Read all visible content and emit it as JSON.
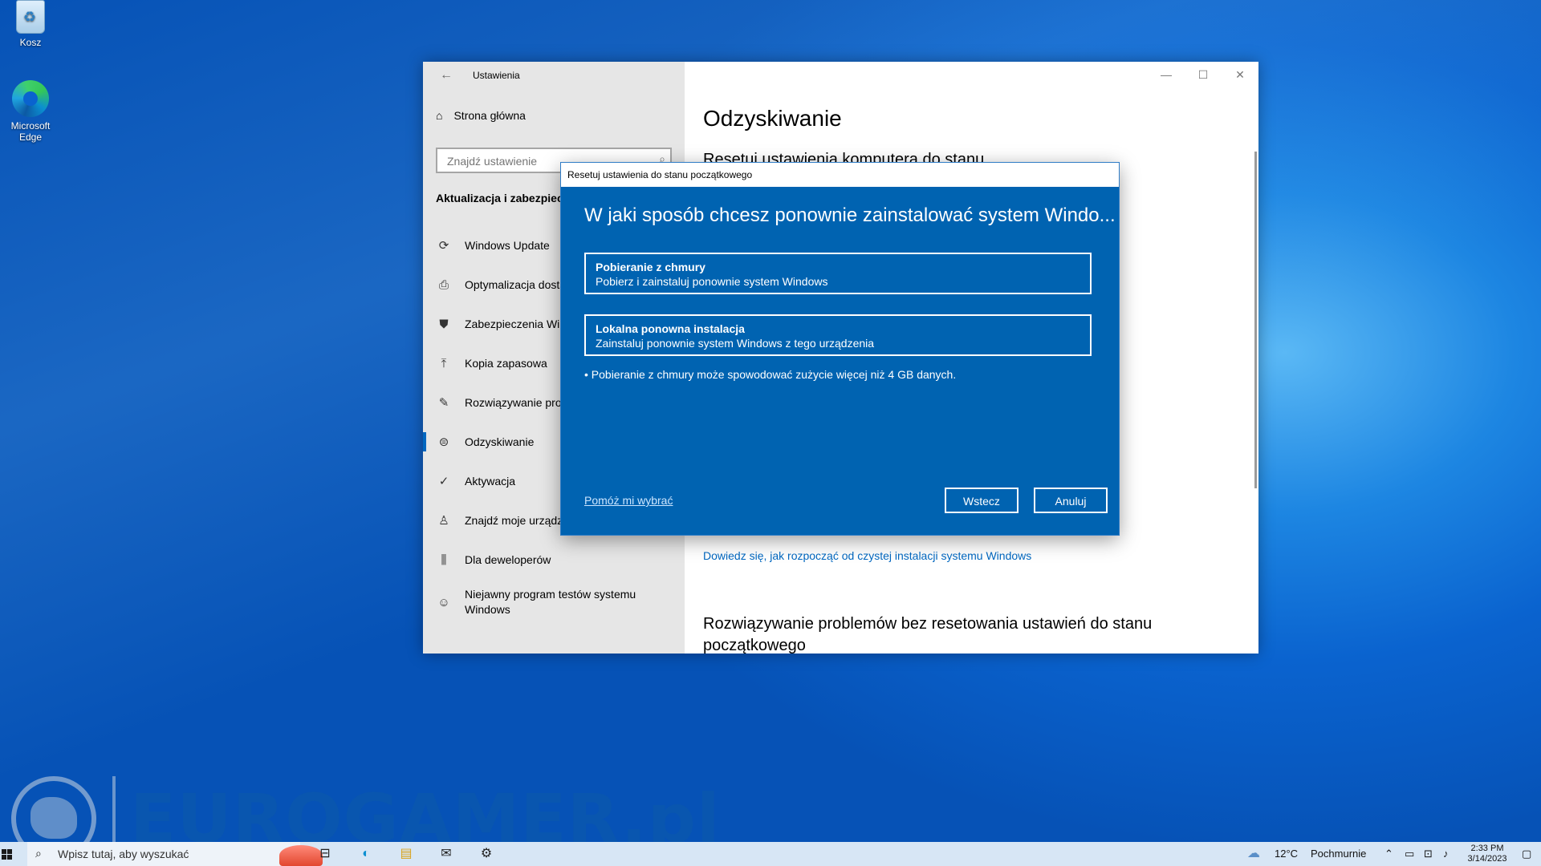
{
  "desktop": {
    "icons": [
      {
        "label": "Kosz",
        "icon": "recycle-bin-icon"
      },
      {
        "label": "Microsoft Edge",
        "icon": "edge-icon"
      }
    ]
  },
  "settings": {
    "window_title": "Ustawienia",
    "home_label": "Strona główna",
    "search_placeholder": "Znajdź ustawienie",
    "section_title": "Aktualizacja i zabezpiecz",
    "nav": [
      {
        "label": "Windows Update",
        "icon": "refresh-icon"
      },
      {
        "label": "Optymalizacja dosta",
        "icon": "delivery-optimization-icon"
      },
      {
        "label": "Zabezpieczenia Win",
        "icon": "shield-icon"
      },
      {
        "label": "Kopia zapasowa",
        "icon": "backup-arrow-icon"
      },
      {
        "label": "Rozwiązywanie prob",
        "icon": "wrench-icon"
      },
      {
        "label": "Odzyskiwanie",
        "icon": "recovery-icon",
        "active": true
      },
      {
        "label": "Aktywacja",
        "icon": "check-circle-icon"
      },
      {
        "label": "Znajdź moje urządz",
        "icon": "person-locate-icon"
      },
      {
        "label": "Dla deweloperów",
        "icon": "developer-icon"
      },
      {
        "label_line1": "Niejawny program testów systemu",
        "label_line2": "Windows",
        "icon": "insider-icon"
      }
    ],
    "content": {
      "title": "Odzyskiwanie",
      "subtitle_partial": "Resetuj ustawienia komputera do stanu",
      "learn_link": "Dowiedz się, jak rozpocząć od czystej instalacji systemu Windows",
      "trouble_heading": "Rozwiązywanie problemów bez resetowania ustawień do stanu początkowego"
    }
  },
  "dialog": {
    "title": "Resetuj ustawienia do stanu początkowego",
    "heading": "W jaki sposób chcesz ponownie zainstalować system Windo...",
    "options": [
      {
        "title": "Pobieranie z chmury",
        "description": "Pobierz i zainstaluj ponownie system Windows"
      },
      {
        "title": "Lokalna ponowna instalacja",
        "description": "Zainstaluj ponownie system Windows z tego urządzenia"
      }
    ],
    "note": "• Pobieranie z chmury może spowodować zużycie więcej niż 4 GB danych.",
    "help_link": "Pomóż mi wybrać",
    "back_button": "Wstecz",
    "cancel_button": "Anuluj"
  },
  "watermark": {
    "text": "EUROGAMER.pl"
  },
  "taskbar": {
    "search_placeholder": "Wpisz tutaj, aby wyszukać",
    "weather_temp": "12°C",
    "weather_text": "Pochmurnie",
    "time": "2:33 PM",
    "date": "3/14/2023"
  },
  "colors": {
    "dialog_bg": "#0063b1",
    "link": "#0067c0",
    "sidebar_bg": "#e6e6e6"
  }
}
